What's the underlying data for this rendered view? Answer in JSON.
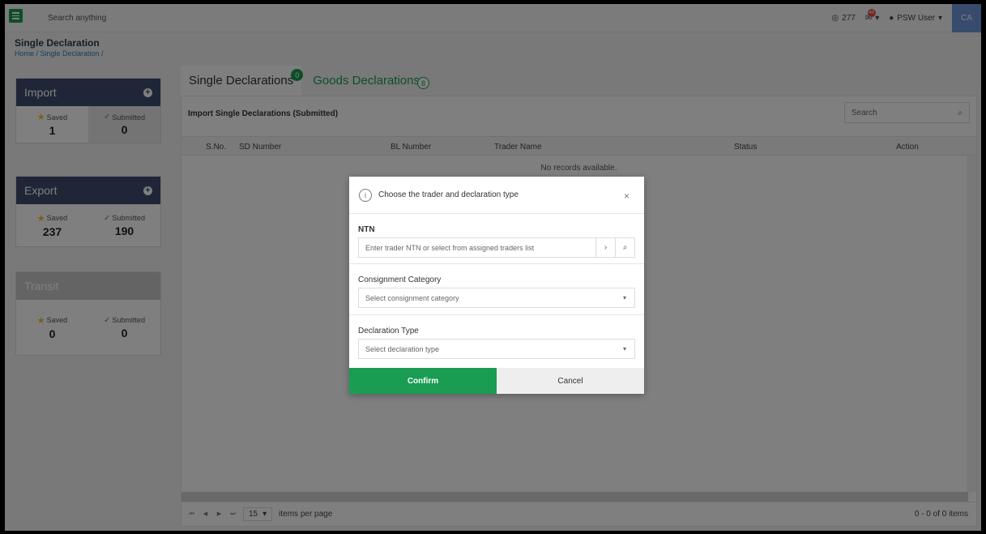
{
  "topbar": {
    "search_placeholder": "Search anything",
    "counter": "277",
    "mail_badge": "40",
    "user": "PSW User",
    "initials": "CA"
  },
  "page": {
    "title": "Single Declaration",
    "breadcrumb": "Home / Single Declaration /"
  },
  "cards": [
    {
      "title": "Import",
      "saved_label": "Saved",
      "saved": "1",
      "submitted_label": "Submitted",
      "submitted": "0"
    },
    {
      "title": "Export",
      "saved_label": "Saved",
      "saved": "237",
      "submitted_label": "Submitted",
      "submitted": "190"
    },
    {
      "title": "Transit",
      "saved_label": "Saved",
      "saved": "0",
      "submitted_label": "Submitted",
      "submitted": "0"
    }
  ],
  "tabs": [
    {
      "label": "Single Declarations",
      "badge": "0"
    },
    {
      "label": "Goods Declarations",
      "badge": "8"
    }
  ],
  "panel": {
    "title": "Import Single Declarations (Submitted)",
    "search_placeholder": "Search",
    "columns": [
      "S.No.",
      "SD Number",
      "BL Number",
      "Trader Name",
      "Status",
      "Action"
    ],
    "empty": "No records available.",
    "per_page": "15",
    "per_page_label": "items per page",
    "info": "0 - 0 of 0 items"
  },
  "modal": {
    "title": "Choose the trader and declaration type",
    "ntn_label": "NTN",
    "ntn_placeholder": "Enter trader NTN or select from assigned traders list",
    "cat_label": "Consignment Category",
    "cat_placeholder": "Select consignment category",
    "type_label": "Declaration Type",
    "type_placeholder": "Select declaration type",
    "confirm": "Confirm",
    "cancel": "Cancel"
  },
  "colors": {
    "brand_green": "#1a9c52",
    "card_header": "#3c4d6e",
    "badge_red": "#e74c3c"
  }
}
